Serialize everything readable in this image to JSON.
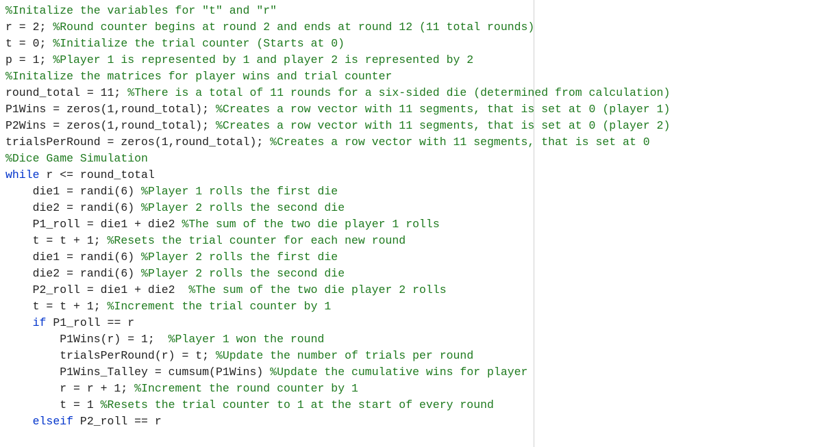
{
  "code": {
    "lines": [
      [
        {
          "cls": "comment",
          "text": "%Initalize the variables for \"t\" and \"r\""
        }
      ],
      [
        {
          "cls": "default",
          "text": "r = 2; "
        },
        {
          "cls": "comment",
          "text": "%Round counter begins at round 2 and ends at round 12 (11 total rounds)"
        }
      ],
      [
        {
          "cls": "default",
          "text": "t = 0; "
        },
        {
          "cls": "comment",
          "text": "%Initialize the trial counter (Starts at 0)"
        }
      ],
      [
        {
          "cls": "default",
          "text": "p = 1; "
        },
        {
          "cls": "comment",
          "text": "%Player 1 is represented by 1 and player 2 is represented by 2"
        }
      ],
      [
        {
          "cls": "comment",
          "text": "%Initalize the matrices for player wins and trial counter"
        }
      ],
      [
        {
          "cls": "default",
          "text": "round_total = 11; "
        },
        {
          "cls": "comment",
          "text": "%There is a total of 11 rounds for a six-sided die (determined from calculation)"
        }
      ],
      [
        {
          "cls": "default",
          "text": "P1Wins = zeros(1,round_total); "
        },
        {
          "cls": "comment",
          "text": "%Creates a row vector with 11 segments, that is set at 0 (player 1)"
        }
      ],
      [
        {
          "cls": "default",
          "text": "P2Wins = zeros(1,round_total); "
        },
        {
          "cls": "comment",
          "text": "%Creates a row vector with 11 segments, that is set at 0 (player 2)"
        }
      ],
      [
        {
          "cls": "default",
          "text": "trialsPerRound = zeros(1,round_total); "
        },
        {
          "cls": "comment",
          "text": "%Creates a row vector with 11 segments, that is set at 0"
        }
      ],
      [
        {
          "cls": "comment",
          "text": "%Dice Game Simulation"
        }
      ],
      [
        {
          "cls": "keyword",
          "text": "while"
        },
        {
          "cls": "default",
          "text": " r <= round_total"
        }
      ],
      [
        {
          "cls": "default",
          "text": "    die1 = randi(6) "
        },
        {
          "cls": "comment",
          "text": "%Player 1 rolls the first die"
        }
      ],
      [
        {
          "cls": "default",
          "text": "    die2 = randi(6) "
        },
        {
          "cls": "comment",
          "text": "%Player 2 rolls the second die"
        }
      ],
      [
        {
          "cls": "default",
          "text": "    P1_roll = die1 + die2 "
        },
        {
          "cls": "comment",
          "text": "%The sum of the two die player 1 rolls"
        }
      ],
      [
        {
          "cls": "default",
          "text": "    t = t + 1; "
        },
        {
          "cls": "comment",
          "text": "%Resets the trial counter for each new round"
        }
      ],
      [
        {
          "cls": "default",
          "text": "    die1 = randi(6) "
        },
        {
          "cls": "comment",
          "text": "%Player 2 rolls the first die"
        }
      ],
      [
        {
          "cls": "default",
          "text": "    die2 = randi(6) "
        },
        {
          "cls": "comment",
          "text": "%Player 2 rolls the second die"
        }
      ],
      [
        {
          "cls": "default",
          "text": "    P2_roll = die1 + die2  "
        },
        {
          "cls": "comment",
          "text": "%The sum of the two die player 2 rolls"
        }
      ],
      [
        {
          "cls": "default",
          "text": "    t = t + 1; "
        },
        {
          "cls": "comment",
          "text": "%Increment the trial counter by 1"
        }
      ],
      [
        {
          "cls": "default",
          "text": "    "
        },
        {
          "cls": "keyword",
          "text": "if"
        },
        {
          "cls": "default",
          "text": " P1_roll == r"
        }
      ],
      [
        {
          "cls": "default",
          "text": "        P1Wins(r) = 1;  "
        },
        {
          "cls": "comment",
          "text": "%Player 1 won the round"
        }
      ],
      [
        {
          "cls": "default",
          "text": "        trialsPerRound(r) = t; "
        },
        {
          "cls": "comment",
          "text": "%Update the number of trials per round"
        }
      ],
      [
        {
          "cls": "default",
          "text": "        P1Wins_Talley = cumsum(P1Wins) "
        },
        {
          "cls": "comment",
          "text": "%Update the cumulative wins for player"
        }
      ],
      [
        {
          "cls": "default",
          "text": "        r = r + 1; "
        },
        {
          "cls": "comment",
          "text": "%Increment the round counter by 1"
        }
      ],
      [
        {
          "cls": "default",
          "text": "        t = 1 "
        },
        {
          "cls": "comment",
          "text": "%Resets the trial counter to 1 at the start of every round"
        }
      ],
      [
        {
          "cls": "default",
          "text": "    "
        },
        {
          "cls": "keyword",
          "text": "elseif"
        },
        {
          "cls": "default",
          "text": " P2_roll == r"
        }
      ]
    ]
  }
}
